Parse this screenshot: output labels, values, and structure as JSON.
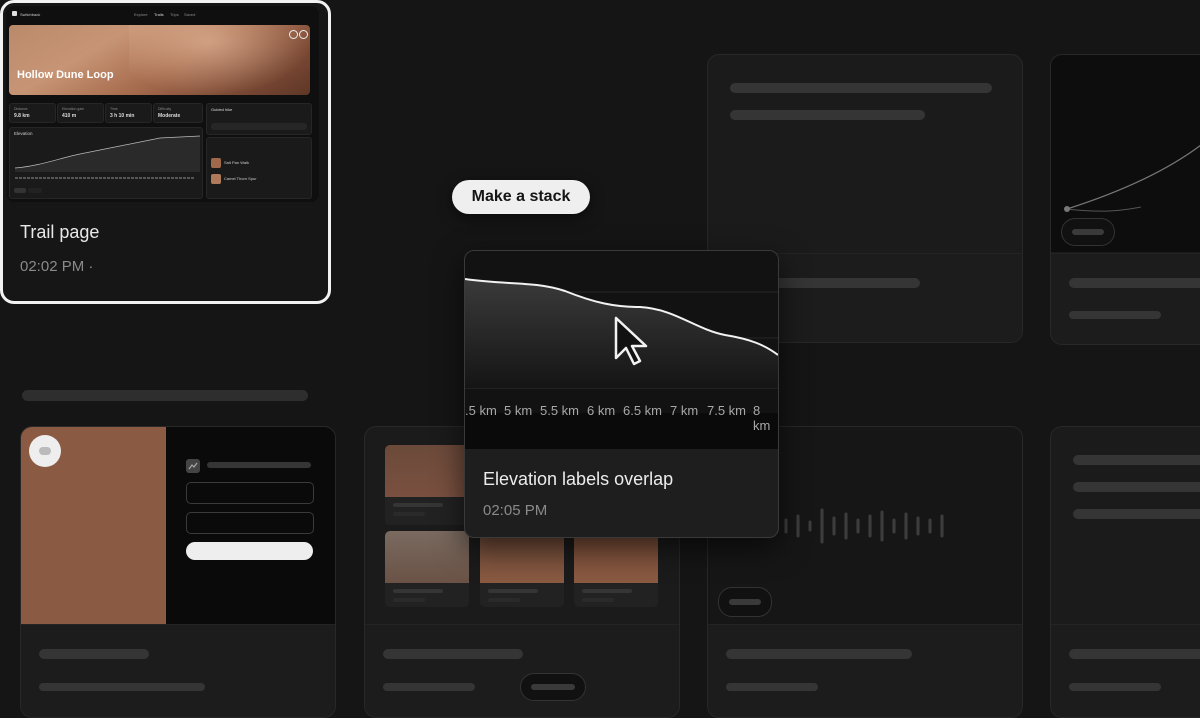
{
  "stack_button_label": "Make a stack",
  "main_card": {
    "caption": "Trail page",
    "time": "02:02 PM ·",
    "screenshot": {
      "app_name": "Switchback",
      "nav": [
        "Explore",
        "Trails",
        "Trips",
        "Saved"
      ],
      "hero_title": "Hollow Dune Loop",
      "stats": [
        {
          "label": "Distance",
          "value": "9.8 km"
        },
        {
          "label": "Elevation gain",
          "value": "410 m"
        },
        {
          "label": "Time",
          "value": "3 h 10 min"
        },
        {
          "label": "Difficulty",
          "value": "Moderate"
        }
      ],
      "elevation_label": "Elevation",
      "side_title": "Guided hike",
      "side_items": [
        "Salt Pan Walk",
        "Camel Thorn Spur"
      ]
    }
  },
  "popup": {
    "title": "Elevation labels overlap",
    "time": "02:05 PM",
    "axis_ticks": [
      ".5 km",
      "5 km",
      "5.5 km",
      "6 km",
      "6.5 km",
      "7 km",
      "7.5 km",
      "8 km"
    ]
  },
  "colors": {
    "accent": "#8a5a42",
    "background": "#151515"
  },
  "icons": [
    "cursor-arrow-icon",
    "chart-icon",
    "logo-icon"
  ]
}
